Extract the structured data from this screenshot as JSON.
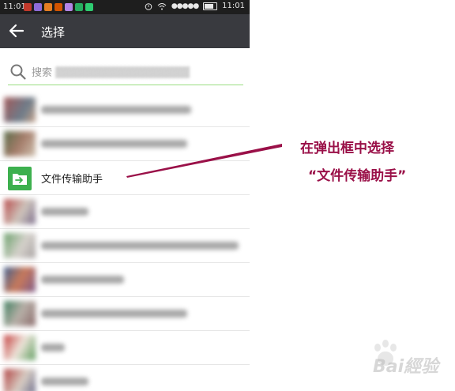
{
  "status_bar": {
    "time": "11:01",
    "clock": "11:01",
    "signal": "●●●●●"
  },
  "header": {
    "title": "选择"
  },
  "search": {
    "placeholder": "搜索"
  },
  "featured": {
    "label": "文件传输助手"
  },
  "annotation": {
    "line1": "在弹出框中选择",
    "line2": "“文件传输助手”"
  },
  "watermark": {
    "text": "Bai經验"
  },
  "colors": {
    "header_bg": "#393a3f",
    "accent_green": "#3db04e",
    "annotation": "#9a1048"
  }
}
